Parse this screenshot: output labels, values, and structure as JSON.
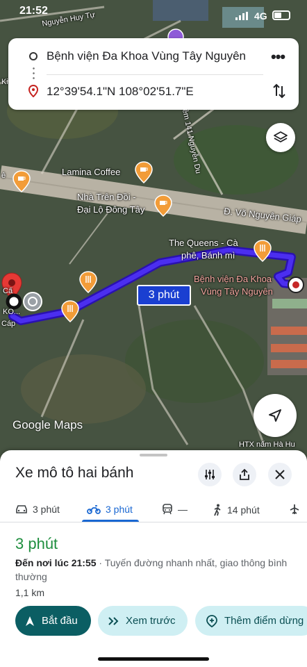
{
  "status_bar": {
    "time": "21:52",
    "network": "4G"
  },
  "route": {
    "origin": "Bệnh viện Đa Khoa Vùng Tây Nguyên",
    "destination": "12°39'54.1\"N 108°02'51.7\"E"
  },
  "map": {
    "labels": {
      "street_top": "Nguyễn Huy Tự",
      "lamina": "Lamina Coffee",
      "nha_tren_doi_1": "Nhà Trên Đồi -",
      "nha_tren_doi_2": "Đại Lộ Đông Tây",
      "hem_141": "Hẻm 141 Nguyễn Du",
      "vo_nguyen_giap": "Đ. Võ Nguyên Giáp",
      "queens_1": "The Queens - Cà",
      "queens_2": "phê, Bánh mì",
      "hospital_1": "Bệnh viện Đa Khoa",
      "hospital_2": "Vùng Tây Nguyên",
      "htx": "HTX nấm Hà Hu",
      "left_1": "Cấ",
      "left_2": "KO...",
      "left_3": "Cáp",
      "left_e": "ê",
      "left_k": "Ki"
    },
    "eta_badge": "3 phút",
    "logo": "Google Maps",
    "colors": {
      "route": "#3b1fe0",
      "poi": "#f29c38",
      "pin": "#e53935"
    }
  },
  "sheet": {
    "title": "Xe mô tô hai bánh",
    "modes": [
      {
        "icon": "car-icon",
        "label": "3 phút"
      },
      {
        "icon": "motorbike-icon",
        "label": "3 phút"
      },
      {
        "icon": "transit-icon",
        "label": "—"
      },
      {
        "icon": "walk-icon",
        "label": "14 phút"
      }
    ],
    "duration": "3 phút",
    "arrival_prefix": "Đến nơi lúc 21:55",
    "arrival_detail": " · Tuyến đường nhanh nhất, giao thông bình thường",
    "distance": "1,1 km",
    "actions": {
      "start": "Bắt đầu",
      "preview": "Xem trước",
      "add_stop": "Thêm điểm dừng"
    }
  }
}
